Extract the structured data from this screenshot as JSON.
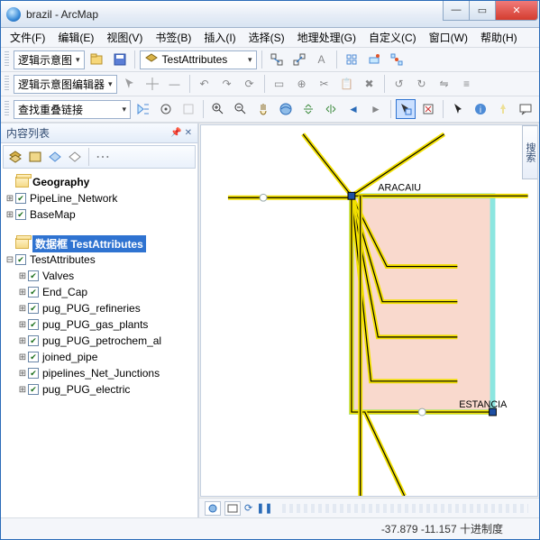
{
  "window": {
    "title": "brazil - ArcMap"
  },
  "menu": [
    "文件(F)",
    "编辑(E)",
    "视图(V)",
    "书签(B)",
    "插入(I)",
    "选择(S)",
    "地理处理(G)",
    "自定义(C)",
    "窗口(W)",
    "帮助(H)"
  ],
  "toolbar1": {
    "dd1": "逻辑示意图",
    "dd2": "TestAttributes"
  },
  "toolbar2": {
    "dd": "逻辑示意图编辑器"
  },
  "toolbar3": {
    "dd": "查找重叠链接"
  },
  "toc": {
    "title": "内容列表",
    "geo_df": "Geography",
    "geo_layers": [
      "PipeLine_Network",
      "BaseMap"
    ],
    "schem_df_label": "数据框 TestAttributes",
    "schem_root": "TestAttributes",
    "schem_layers": [
      "Valves",
      "End_Cap",
      "pug_PUG_refineries",
      "pug_PUG_gas_plants",
      "pug_PUG_petrochem_al",
      "joined_pipe",
      "pipelines_Net_Junctions",
      "pug_PUG_electric"
    ]
  },
  "map": {
    "label1": "ARACAIU",
    "label2": "ESTANCIA",
    "side_tab": "搜索"
  },
  "status": {
    "coords": "-37.879  -11.157 十进制度"
  }
}
